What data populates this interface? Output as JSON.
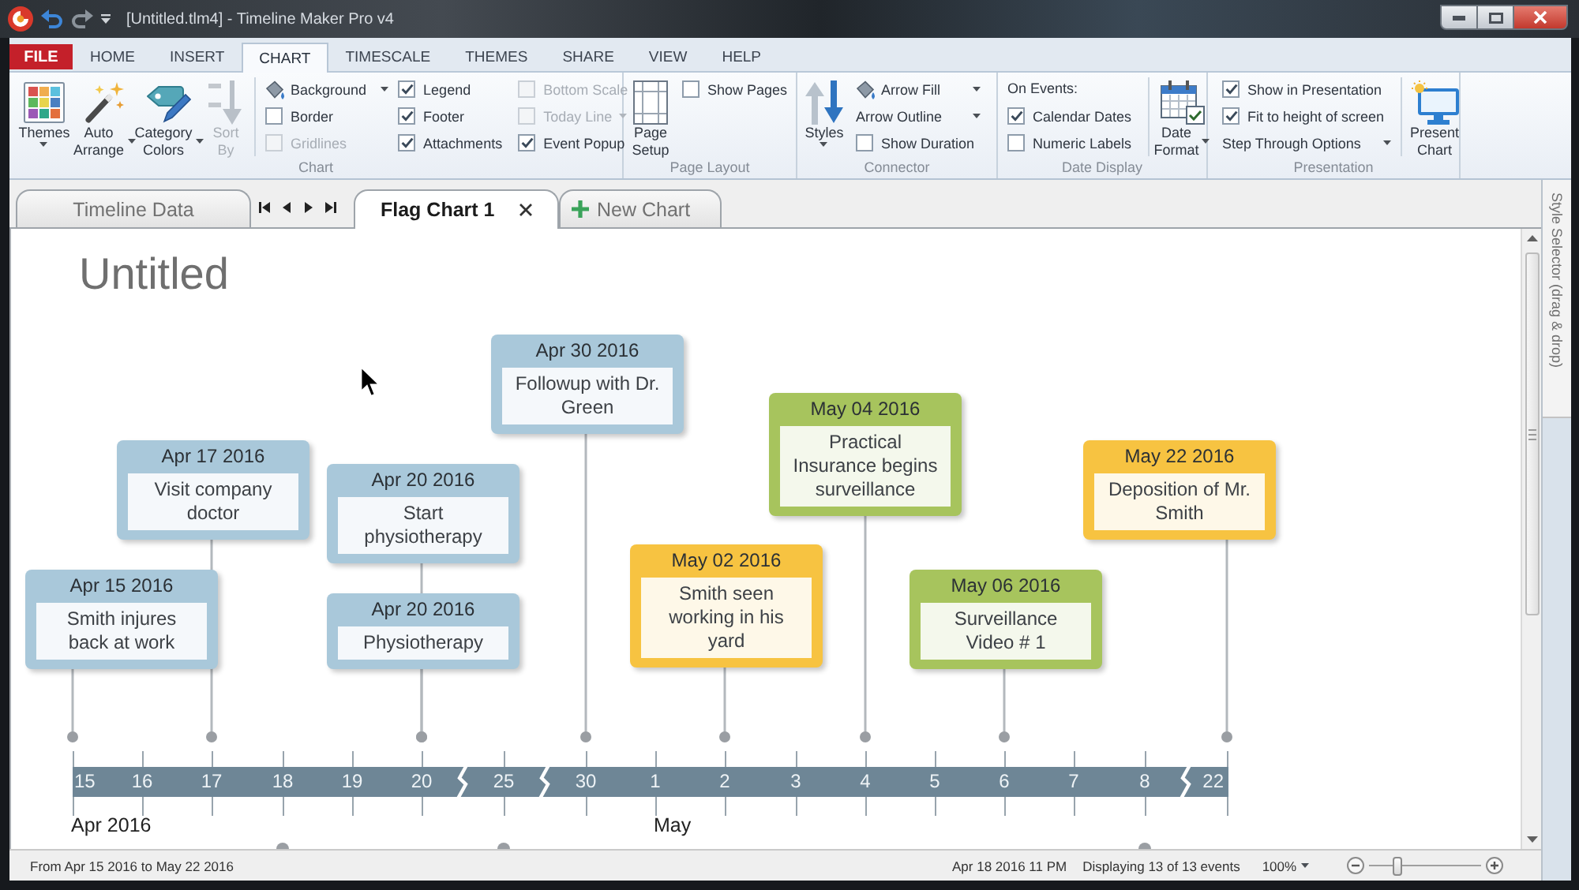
{
  "window": {
    "title": "[Untitled.tlm4] - Timeline Maker Pro v4"
  },
  "ribbon_tabs": [
    {
      "label": "FILE",
      "kind": "file",
      "selected": false
    },
    {
      "label": "HOME",
      "kind": "tab",
      "selected": false
    },
    {
      "label": "INSERT",
      "kind": "tab",
      "selected": false
    },
    {
      "label": "CHART",
      "kind": "tab",
      "selected": true
    },
    {
      "label": "TIMESCALE",
      "kind": "tab",
      "selected": false
    },
    {
      "label": "THEMES",
      "kind": "tab",
      "selected": false
    },
    {
      "label": "SHARE",
      "kind": "tab",
      "selected": false
    },
    {
      "label": "VIEW",
      "kind": "tab",
      "selected": false
    },
    {
      "label": "HELP",
      "kind": "tab",
      "selected": false
    }
  ],
  "ribbon_groups": [
    {
      "label": "Chart",
      "items": [
        {
          "kind": "large",
          "label": "Themes",
          "dropdown": true,
          "disabled": false
        },
        {
          "kind": "large",
          "label": "Auto\nArrange",
          "dropdown": true,
          "disabled": false
        },
        {
          "kind": "large",
          "label": "Category\nColors",
          "dropdown": true,
          "disabled": false
        },
        {
          "kind": "large",
          "label": "Sort\nBy",
          "dropdown": false,
          "disabled": true
        },
        {
          "kind": "separator"
        },
        {
          "kind": "stack",
          "rows": [
            {
              "kind": "fill",
              "label": "Background",
              "dropdown": true,
              "disabled": false
            },
            {
              "kind": "checkbox",
              "label": "Border",
              "checked": false,
              "dropdown": false,
              "disabled": false
            },
            {
              "kind": "checkbox",
              "label": "Gridlines",
              "checked": false,
              "dropdown": false,
              "disabled": true
            }
          ]
        },
        {
          "kind": "stack",
          "rows": [
            {
              "kind": "checkbox",
              "label": "Legend",
              "checked": true,
              "dropdown": false,
              "disabled": false
            },
            {
              "kind": "checkbox",
              "label": "Footer",
              "checked": true,
              "dropdown": false,
              "disabled": false
            },
            {
              "kind": "checkbox",
              "label": "Attachments",
              "checked": true,
              "dropdown": false,
              "disabled": false
            }
          ]
        },
        {
          "kind": "stack",
          "rows": [
            {
              "kind": "checkbox",
              "label": "Bottom Scale",
              "checked": false,
              "dropdown": false,
              "disabled": true
            },
            {
              "kind": "checkbox",
              "label": "Today Line",
              "checked": false,
              "dropdown": true,
              "disabled": true
            },
            {
              "kind": "checkbox",
              "label": "Event Popup",
              "checked": true,
              "dropdown": false,
              "disabled": false
            }
          ]
        }
      ]
    },
    {
      "label": "Page Layout",
      "items": [
        {
          "kind": "large",
          "label": "Page\nSetup",
          "dropdown": false,
          "disabled": false
        },
        {
          "kind": "stack",
          "rows": [
            {
              "kind": "checkbox",
              "label": "Show Pages",
              "checked": false,
              "dropdown": false,
              "disabled": false
            }
          ]
        }
      ]
    },
    {
      "label": "Connector",
      "items": [
        {
          "kind": "large",
          "label": "Styles",
          "dropdown": true,
          "disabled": false
        },
        {
          "kind": "stack",
          "rows": [
            {
              "kind": "fill",
              "label": "Arrow Fill",
              "dropdown": true,
              "disabled": false
            },
            {
              "kind": "menu",
              "label": "Arrow Outline",
              "dropdown": true,
              "disabled": false
            },
            {
              "kind": "checkbox",
              "label": "Show Duration",
              "checked": false,
              "dropdown": false,
              "disabled": false
            }
          ]
        }
      ]
    },
    {
      "label": "Date Display",
      "items": [
        {
          "kind": "stack",
          "rows": [
            {
              "kind": "label",
              "label": "On Events:"
            },
            {
              "kind": "checkbox",
              "label": "Calendar Dates",
              "checked": true,
              "dropdown": false,
              "disabled": false
            },
            {
              "kind": "checkbox",
              "label": "Numeric Labels",
              "checked": false,
              "dropdown": false,
              "disabled": false
            }
          ]
        },
        {
          "kind": "separator"
        },
        {
          "kind": "large",
          "label": "Date\nFormat",
          "dropdown": true,
          "disabled": false
        }
      ]
    },
    {
      "label": "Presentation",
      "items": [
        {
          "kind": "stack",
          "rows": [
            {
              "kind": "checkbox",
              "label": "Show in Presentation",
              "checked": true,
              "dropdown": false,
              "disabled": false
            },
            {
              "kind": "checkbox",
              "label": "Fit to height of screen",
              "checked": true,
              "dropdown": false,
              "disabled": false
            },
            {
              "kind": "menu",
              "label": "Step Through Options",
              "dropdown": true,
              "disabled": false
            }
          ]
        },
        {
          "kind": "separator"
        },
        {
          "kind": "large",
          "label": "Present\nChart",
          "dropdown": false,
          "disabled": false
        }
      ]
    }
  ],
  "document_tabs": [
    {
      "kind": "data",
      "label": "Timeline Data",
      "selected": false
    },
    {
      "kind": "chart",
      "label": "Flag Chart 1",
      "selected": true
    },
    {
      "kind": "new",
      "label": "New Chart",
      "selected": false
    }
  ],
  "side_panel": {
    "label": "Style Selector (drag & drop)"
  },
  "chart": {
    "title": "Untitled",
    "events": [
      {
        "date": "Apr 15 2016",
        "text": "Smith injures\nback at work",
        "color": "#a9c8da"
      },
      {
        "date": "Apr 17 2016",
        "text": "Visit company\ndoctor",
        "color": "#a9c8da"
      },
      {
        "date": "Apr 20 2016",
        "text": "Start\nphysiotherapy",
        "color": "#a9c8da"
      },
      {
        "date": "Apr 20 2016",
        "text": "Physiotherapy",
        "color": "#a9c8da"
      },
      {
        "date": "Apr 30 2016",
        "text": "Followup with Dr.\nGreen",
        "color": "#a9c8da"
      },
      {
        "date": "May 02 2016",
        "text": "Smith seen\nworking in his\nyard",
        "color": "#f7c341"
      },
      {
        "date": "May 04 2016",
        "text": "Practical\nInsurance begins\nsurveillance",
        "color": "#a7c45d"
      },
      {
        "date": "May 06 2016",
        "text": "Surveillance\nVideo # 1",
        "color": "#a7c45d"
      },
      {
        "date": "May 22 2016",
        "text": "Deposition of Mr.\nSmith",
        "color": "#f7c341"
      }
    ],
    "scale": [
      {
        "kind": "day",
        "label": "15",
        "month": "Apr 2016",
        "marker_below": false
      },
      {
        "kind": "day",
        "label": "16",
        "marker_below": false
      },
      {
        "kind": "day",
        "label": "17",
        "marker_below": false
      },
      {
        "kind": "day",
        "label": "18",
        "marker_below": true
      },
      {
        "kind": "day",
        "label": "19",
        "marker_below": false
      },
      {
        "kind": "day",
        "label": "20",
        "marker_below": false
      },
      {
        "kind": "break",
        "marker_below": false
      },
      {
        "kind": "day",
        "label": "25",
        "marker_below": true
      },
      {
        "kind": "break",
        "marker_below": false
      },
      {
        "kind": "day",
        "label": "30",
        "marker_below": false
      },
      {
        "kind": "day",
        "label": "1",
        "month": "May",
        "marker_below": false
      },
      {
        "kind": "day",
        "label": "2",
        "marker_below": false
      },
      {
        "kind": "day",
        "label": "3",
        "marker_below": false
      },
      {
        "kind": "day",
        "label": "4",
        "marker_below": false
      },
      {
        "kind": "day",
        "label": "5",
        "marker_below": false
      },
      {
        "kind": "day",
        "label": "6",
        "marker_below": false
      },
      {
        "kind": "day",
        "label": "7",
        "marker_below": false
      },
      {
        "kind": "day",
        "label": "8",
        "marker_below": true
      },
      {
        "kind": "break",
        "marker_below": false
      },
      {
        "kind": "day",
        "label": "22",
        "marker_below": false
      }
    ]
  },
  "status_bar": {
    "range": "From Apr 15 2016 to May 22 2016",
    "date": "Apr 18 2016 11 PM",
    "events": "Displaying 13 of 13 events",
    "zoom": "100%",
    "zoom_slider": {
      "level": 0.22
    }
  }
}
